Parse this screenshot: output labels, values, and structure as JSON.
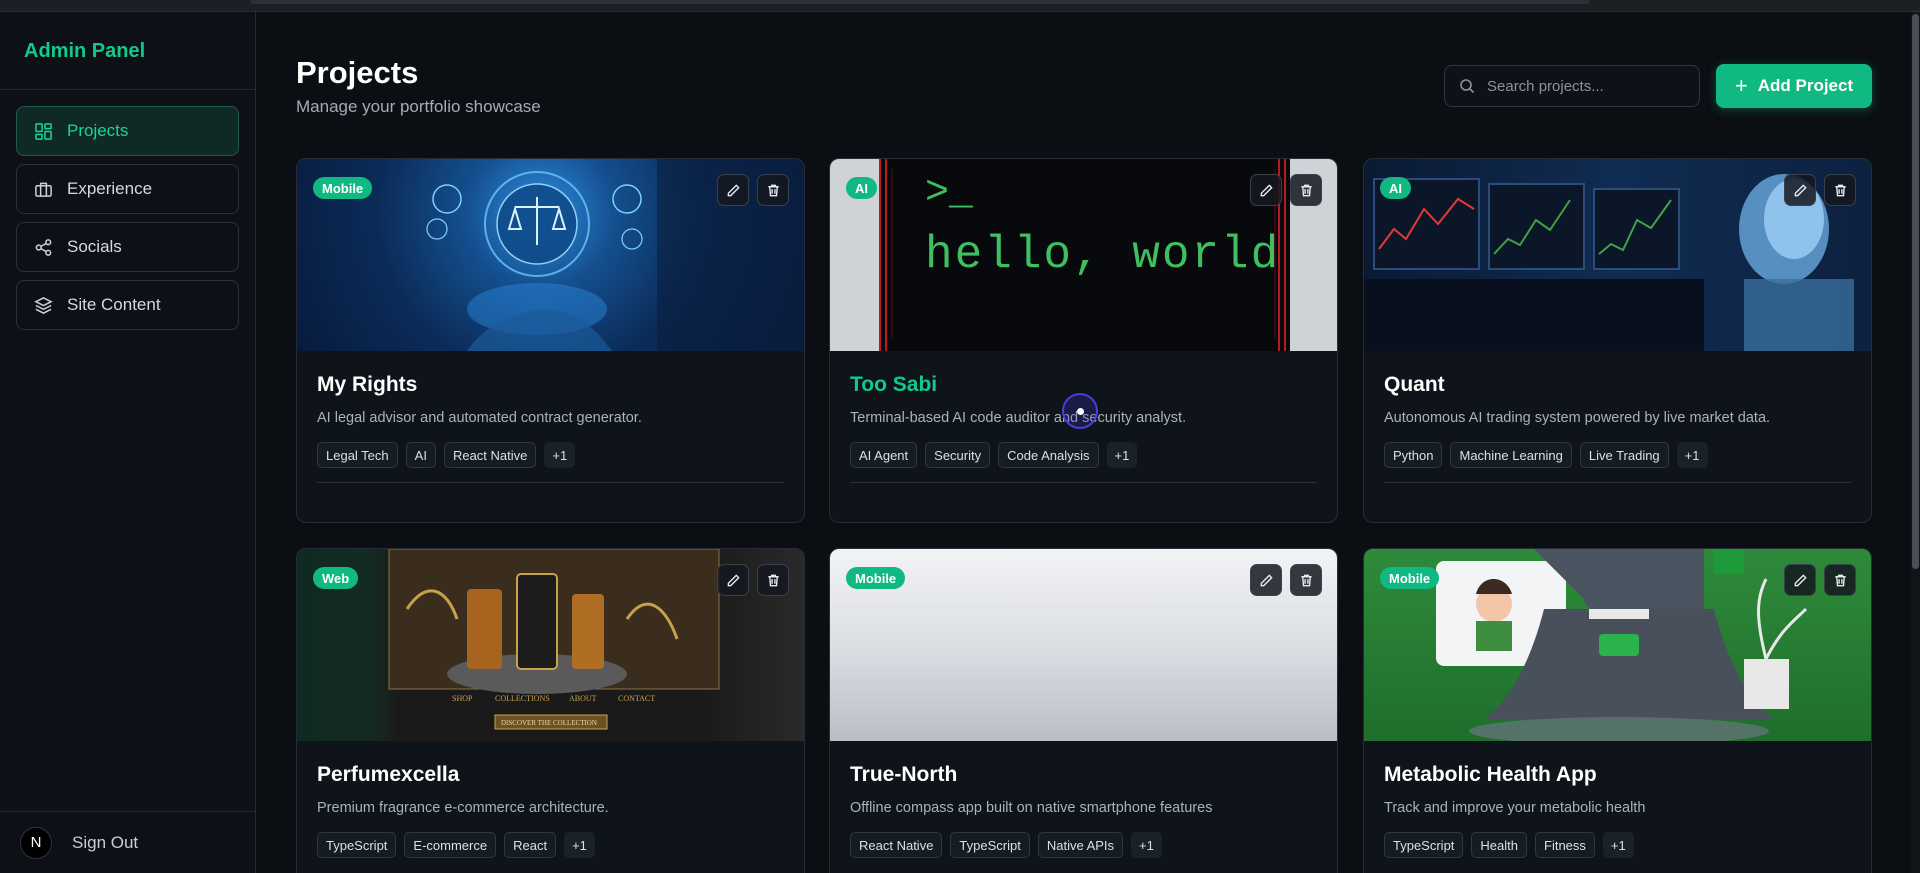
{
  "sidebar": {
    "brand": "Admin Panel",
    "items": [
      {
        "label": "Projects"
      },
      {
        "label": "Experience"
      },
      {
        "label": "Socials"
      },
      {
        "label": "Site Content"
      }
    ],
    "avatar_letter": "N",
    "signout": "Sign Out"
  },
  "header": {
    "title": "Projects",
    "subtitle": "Manage your portfolio showcase",
    "search_placeholder": "Search projects...",
    "add_label": "Add Project"
  },
  "projects": [
    {
      "badge": "Mobile",
      "title": "My Rights",
      "desc": "AI legal advisor and automated contract generator.",
      "tags": [
        "Legal Tech",
        "AI",
        "React Native"
      ],
      "more": "+1"
    },
    {
      "badge": "AI",
      "title": "Too Sabi",
      "desc": "Terminal-based AI code auditor and security analyst.",
      "tags": [
        "AI Agent",
        "Security",
        "Code Analysis"
      ],
      "more": "+1",
      "image_text": {
        "prompt": ">_",
        "hello": "hello, world"
      }
    },
    {
      "badge": "AI",
      "title": "Quant",
      "desc": "Autonomous AI trading system powered by live market data.",
      "tags": [
        "Python",
        "Machine Learning",
        "Live Trading"
      ],
      "more": "+1"
    },
    {
      "badge": "Web",
      "title": "Perfumexcella",
      "desc": "Premium fragrance e-commerce architecture.",
      "tags": [
        "TypeScript",
        "E-commerce",
        "React"
      ],
      "more": "+1",
      "image_text": {
        "nav": [
          "SHOP",
          "COLLECTIONS",
          "ABOUT",
          "CONTACT"
        ],
        "cta": "DISCOVER THE COLLECTION"
      }
    },
    {
      "badge": "Mobile",
      "title": "True-North",
      "desc": "Offline compass app built on native smartphone features",
      "tags": [
        "React Native",
        "TypeScript",
        "Native APIs"
      ],
      "more": "+1"
    },
    {
      "badge": "Mobile",
      "title": "Metabolic Health App",
      "desc": "Track and improve your metabolic health",
      "tags": [
        "TypeScript",
        "Health",
        "Fitness"
      ],
      "more": "+1"
    }
  ],
  "colors": {
    "accent": "#10b981",
    "background": "#0b0e13",
    "sidebar": "#0d1117"
  }
}
